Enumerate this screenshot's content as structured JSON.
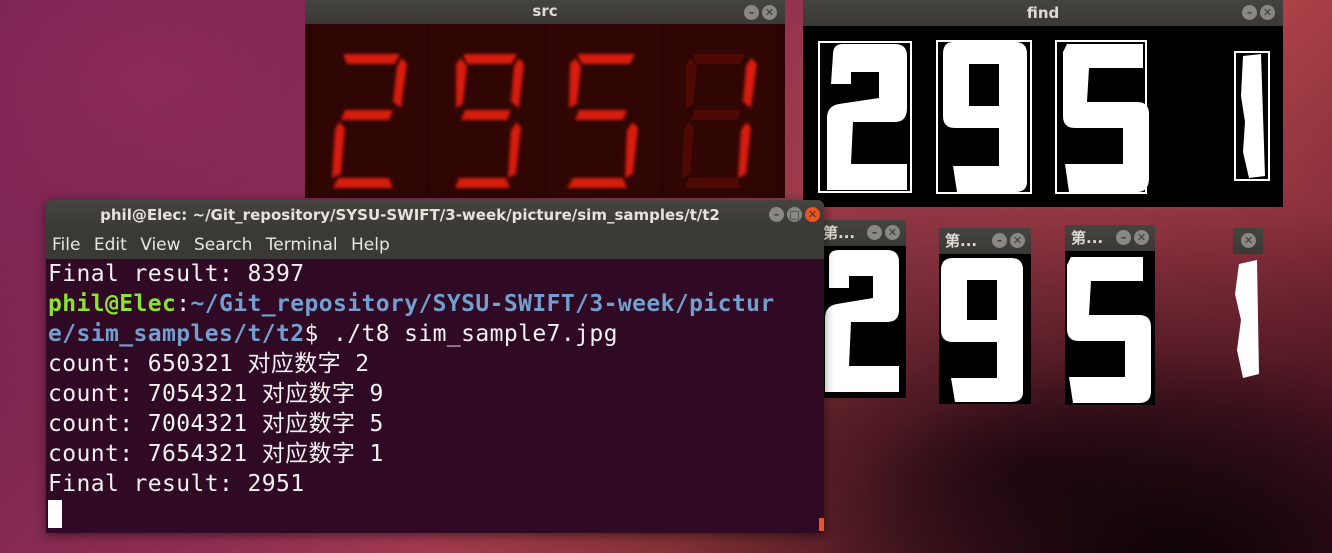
{
  "src_window": {
    "title": "src",
    "digits": [
      "2",
      "9",
      "5",
      "1"
    ]
  },
  "find_window": {
    "title": "find",
    "digits": [
      "2",
      "9",
      "5",
      "1"
    ]
  },
  "digit_windows": [
    {
      "title": "第...",
      "digit": "2"
    },
    {
      "title": "第...",
      "digit": "9"
    },
    {
      "title": "第...",
      "digit": "5"
    },
    {
      "title": "",
      "digit": "1"
    }
  ],
  "terminal": {
    "title": "phil@Elec: ~/Git_repository/SYSU-SWIFT/3-week/picture/sim_samples/t/t2",
    "menu": [
      "File",
      "Edit",
      "View",
      "Search",
      "Terminal",
      "Help"
    ],
    "line0": "Final result: 8397",
    "prompt_user": "phil@Elec",
    "prompt_sep": ":",
    "prompt_path_1": "~/Git_repository/SYSU-SWIFT/3-week/pictur",
    "prompt_path_2": "e/sim_samples/t/t2",
    "prompt_cmd": "$ ./t8 sim_sample7.jpg",
    "lines": [
      "count: 650321 对应数字 2",
      "count: 7054321 对应数字 9",
      "count: 7004321 对应数字 5",
      "count: 7654321 对应数字 1",
      "Final result: 2951"
    ]
  },
  "colors": {
    "terminal_bg": "#300a24",
    "prompt_user": "#8ae234",
    "prompt_path": "#729fcf",
    "led_red": "#d81a10",
    "ubuntu_orange": "#e95420"
  }
}
